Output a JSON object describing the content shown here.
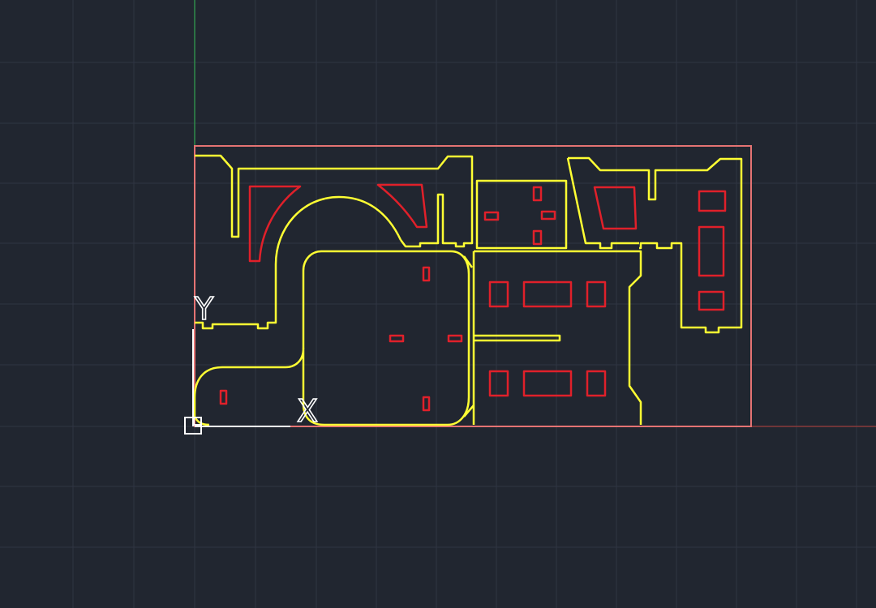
{
  "viewport": {
    "background": "#212630",
    "grid_color": "#2F3542",
    "grid_major_color": "#343b48",
    "x_axis_color": "#8a3a3a",
    "y_axis_color": "#2f8a4a"
  },
  "ucs_icon": {
    "x_label": "X",
    "y_label": "Y",
    "color": "#ffffff",
    "icon": "ucs-icon"
  },
  "layers": {
    "border": {
      "color": "#e57373"
    },
    "walls": {
      "color": "#ffff33"
    },
    "furniture": {
      "color": "#e0202a"
    }
  }
}
